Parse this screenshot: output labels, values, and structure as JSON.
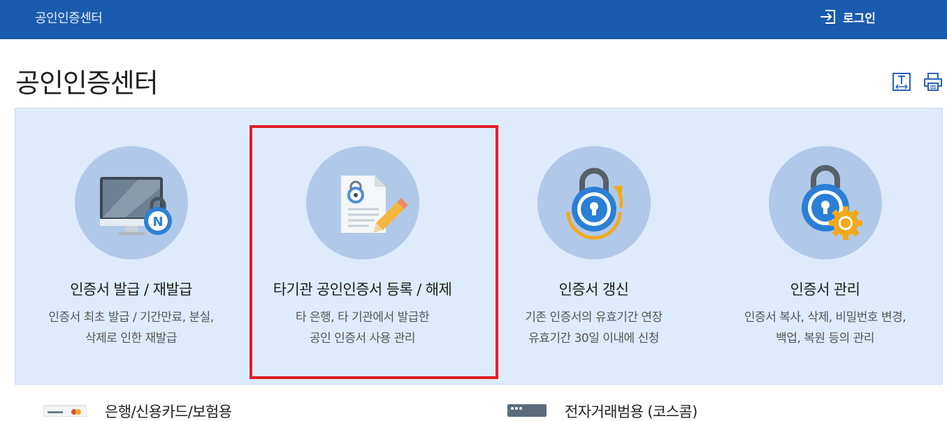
{
  "header": {
    "site_title": "공인인증센터",
    "login_label": "로그인"
  },
  "page": {
    "title": "공인인증센터"
  },
  "cards": [
    {
      "title": "인증서 발급 / 재발급",
      "desc1": "인증서 최초 발급 / 기간만료, 분실,",
      "desc2": "삭제로 인한 재발급",
      "icon": "monitor-lock-icon"
    },
    {
      "title": "타기관 공인인증서 등록 / 해제",
      "desc1": "타 은행, 타 기관에서 발급한",
      "desc2": "공인 인증서 사용 관리",
      "icon": "document-pen-icon"
    },
    {
      "title": "인증서 갱신",
      "desc1": "기존 인증서의 유효기간 연장",
      "desc2": "유효기간 30일 이내에 신청",
      "icon": "lock-refresh-icon"
    },
    {
      "title": "인증서 관리",
      "desc1": "인증서 복사, 삭제, 비밀번호 변경,",
      "desc2": "백업, 복원 등의 관리",
      "icon": "lock-gear-icon"
    }
  ],
  "bottom": [
    {
      "label": "은행/신용카드/보험용",
      "icon": "card-icon"
    },
    {
      "label": "전자거래범용 (코스콤)",
      "icon": "browser-icon"
    }
  ],
  "colors": {
    "header_bg": "#1a5bad",
    "panel_bg": "#deebfc",
    "circle_bg": "#b0c9e8",
    "highlight": "#e01f26"
  }
}
